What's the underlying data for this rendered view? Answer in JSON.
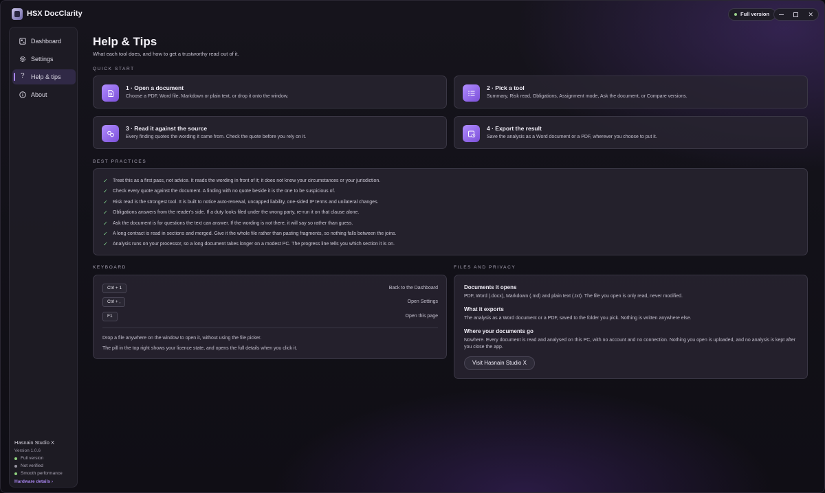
{
  "app": {
    "title": "HSX DocClarity",
    "license_pill": "Full version"
  },
  "window_controls": {
    "minimize": "minimize",
    "maximize": "maximize",
    "close": "✕"
  },
  "sidebar": {
    "items": [
      {
        "label": "Dashboard",
        "icon": "dashboard-icon",
        "active": false
      },
      {
        "label": "Settings",
        "icon": "gear-icon",
        "active": false
      },
      {
        "label": "Help & tips",
        "icon": "question-icon",
        "active": true
      },
      {
        "label": "About",
        "icon": "info-icon",
        "active": false
      }
    ],
    "footer": {
      "company": "Hasnain Studio X",
      "version": "Version 1.0.6",
      "statuses": [
        {
          "label": "Full version",
          "color": "#8fd07e"
        },
        {
          "label": "Not verified",
          "color": "#9a96a3"
        },
        {
          "label": "Smooth performance",
          "color": "#8fd07e"
        }
      ],
      "hardware_link": "Hardware details ›"
    }
  },
  "page": {
    "title": "Help & Tips",
    "subtitle": "What each tool does, and how to get a trustworthy read out of it."
  },
  "quick_start": {
    "label": "QUICK START",
    "cards": [
      {
        "title": "1 · Open a document",
        "desc": "Choose a PDF, Word file, Markdown or plain text, or drop it onto the window.",
        "icon": "file-open-icon"
      },
      {
        "title": "2 · Pick a tool",
        "desc": "Summary, Risk read, Obligations, Assignment mode, Ask the document, or Compare versions.",
        "icon": "list-check-icon"
      },
      {
        "title": "3 · Read it against the source",
        "desc": "Every finding quotes the wording it came from. Check the quote before you rely on it.",
        "icon": "compare-icon"
      },
      {
        "title": "4 · Export the result",
        "desc": "Save the analysis as a Word document or a PDF, wherever you choose to put it.",
        "icon": "export-icon"
      }
    ]
  },
  "best_practices": {
    "label": "BEST PRACTICES",
    "items": [
      "Treat this as a first pass, not advice. It reads the wording in front of it; it does not know your circumstances or your jurisdiction.",
      "Check every quote against the document. A finding with no quote beside it is the one to be suspicious of.",
      "Risk read is the strongest tool. It is built to notice auto-renewal, uncapped liability, one-sided IP terms and unilateral changes.",
      "Obligations answers from the reader's side. If a duty looks filed under the wrong party, re-run it on that clause alone.",
      "Ask the document is for questions the text can answer. If the wording is not there, it will say so rather than guess.",
      "A long contract is read in sections and merged. Give it the whole file rather than pasting fragments, so nothing falls between the joins.",
      "Analysis runs on your processor, so a long document takes longer on a modest PC. The progress line tells you which section it is on."
    ]
  },
  "keyboard": {
    "label": "KEYBOARD",
    "shortcuts": [
      {
        "keys": "Ctrl + 1",
        "action": "Back to the Dashboard"
      },
      {
        "keys": "Ctrl + ,",
        "action": "Open Settings"
      },
      {
        "keys": "F1",
        "action": "Open this page"
      }
    ],
    "notes": [
      "Drop a file anywhere on the window to open it, without using the file picker.",
      "The pill in the top right shows your licence state, and opens the full details when you click it."
    ]
  },
  "files_privacy": {
    "label": "FILES AND PRIVACY",
    "sections": [
      {
        "title": "Documents it opens",
        "text": "PDF, Word (.docx), Markdown (.md) and plain text (.txt). The file you open is only read, never modified."
      },
      {
        "title": "What it exports",
        "text": "The analysis as a Word document or a PDF, saved to the folder you pick. Nothing is written anywhere else."
      },
      {
        "title": "Where your documents go",
        "text": "Nowhere. Every document is read and analysed on this PC, with no account and no connection. Nothing you open is uploaded, and no analysis is kept after you close the app."
      }
    ],
    "button": "Visit Hasnain Studio X"
  },
  "colors": {
    "accent": "#a985f0",
    "check": "#7fcf8b",
    "ok": "#8fd07e",
    "muted": "#9a96a3"
  }
}
